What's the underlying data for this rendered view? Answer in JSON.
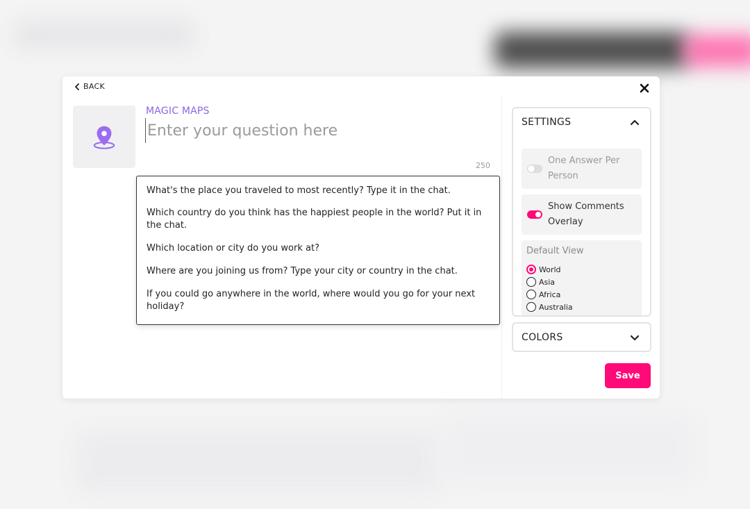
{
  "header": {
    "back_label": "BACK"
  },
  "question": {
    "category_label": "MAGIC MAPS",
    "placeholder": "Enter your question here",
    "value": "",
    "char_limit": "250"
  },
  "suggestions": [
    "What's the place you traveled to most recently? Type it in the chat.",
    "Which country do you think has the happiest people in the world? Put it in the chat.",
    "Which location or city do you work at?",
    "Where are you joining us from? Type your city or country in the chat.",
    "If you could go anywhere in the world, where would you go for your next holiday?"
  ],
  "settings": {
    "title": "SETTINGS",
    "one_answer": {
      "label": "One Answer Per Person",
      "enabled": false
    },
    "show_comments": {
      "label": "Show Comments Overlay",
      "enabled": true
    },
    "default_view": {
      "title": "Default View",
      "selected": "World",
      "options": [
        "World",
        "Asia",
        "Africa",
        "Australia"
      ]
    }
  },
  "colors": {
    "title": "COLORS"
  },
  "save_label": "Save",
  "theme": {
    "accent": "#ff0a78",
    "purple": "#8e63e6"
  }
}
